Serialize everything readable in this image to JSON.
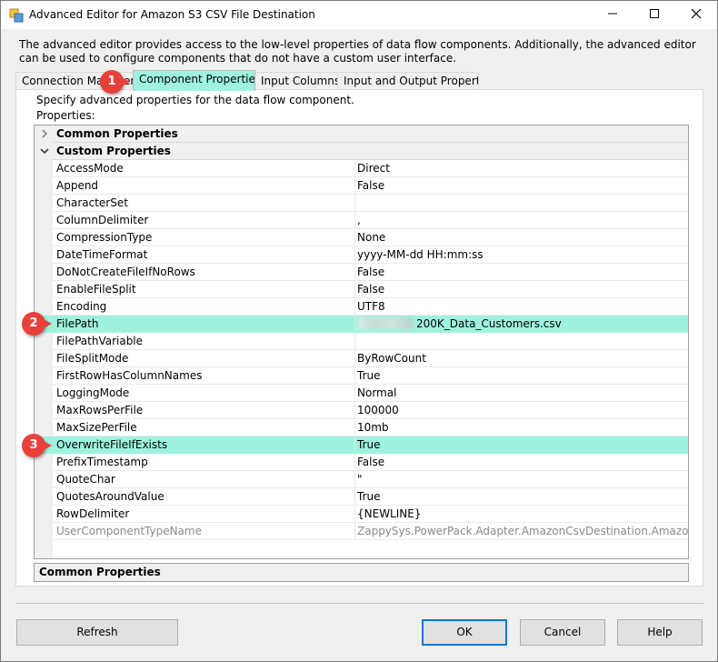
{
  "window": {
    "title": "Advanced Editor for Amazon S3 CSV File Destination"
  },
  "description": "The advanced editor provides access to the low-level properties of data flow components. Additionally, the advanced editor can be used to configure components that do not have a custom user interface.",
  "tabs": [
    {
      "label": "Connection Managers",
      "active": false
    },
    {
      "label": "Component Properties",
      "active": true
    },
    {
      "label": "Input Columns",
      "active": false
    },
    {
      "label": "Input and Output Properties",
      "active": false
    }
  ],
  "panel": {
    "hint": "Specify advanced properties for the data flow component.",
    "properties_label": "Properties:"
  },
  "categories": {
    "common": "Common Properties",
    "custom": "Custom Properties"
  },
  "properties": [
    {
      "name": "AccessMode",
      "value": "Direct"
    },
    {
      "name": "Append",
      "value": "False"
    },
    {
      "name": "CharacterSet",
      "value": ""
    },
    {
      "name": "ColumnDelimiter",
      "value": ","
    },
    {
      "name": "CompressionType",
      "value": "None"
    },
    {
      "name": "DateTimeFormat",
      "value": "yyyy-MM-dd HH:mm:ss"
    },
    {
      "name": "DoNotCreateFileIfNoRows",
      "value": "False"
    },
    {
      "name": "EnableFileSplit",
      "value": "False"
    },
    {
      "name": "Encoding",
      "value": "UTF8"
    },
    {
      "name": "FilePath",
      "value": "200K_Data_Customers.csv"
    },
    {
      "name": "FilePathVariable",
      "value": ""
    },
    {
      "name": "FileSplitMode",
      "value": "ByRowCount"
    },
    {
      "name": "FirstRowHasColumnNames",
      "value": "True"
    },
    {
      "name": "LoggingMode",
      "value": "Normal"
    },
    {
      "name": "MaxRowsPerFile",
      "value": "100000"
    },
    {
      "name": "MaxSizePerFile",
      "value": "10mb"
    },
    {
      "name": "OverwriteFileIfExists",
      "value": "True"
    },
    {
      "name": "PrefixTimestamp",
      "value": "False"
    },
    {
      "name": "QuoteChar",
      "value": "\""
    },
    {
      "name": "QuotesAroundValue",
      "value": "True"
    },
    {
      "name": "RowDelimiter",
      "value": "{NEWLINE}"
    },
    {
      "name": "UserComponentTypeName",
      "value": "ZappySys.PowerPack.Adapter.AmazonCsvDestination.AmazonCsvDestination"
    }
  ],
  "property_description": "Common Properties",
  "badges": [
    "1",
    "2",
    "3"
  ],
  "buttons": {
    "refresh": "Refresh",
    "ok": "OK",
    "cancel": "Cancel",
    "help": "Help"
  },
  "colors": {
    "highlight": "#9ff3de",
    "badge": "#e8413c",
    "default_button_border": "#0078d7"
  },
  "icons": {
    "app": "component-editor-icon",
    "minimize": "minimize-icon",
    "maximize": "maximize-icon",
    "close": "close-icon",
    "collapsed": "chevron-right-icon",
    "expanded": "chevron-down-icon"
  }
}
